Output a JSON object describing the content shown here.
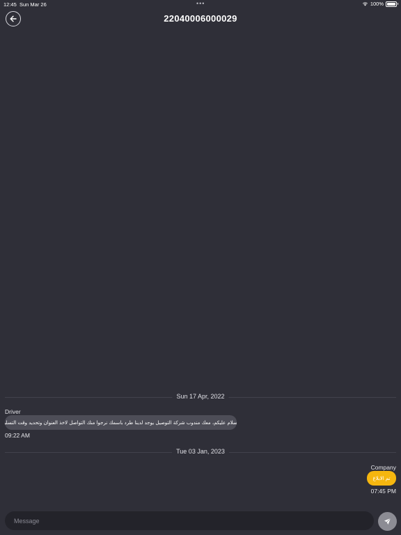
{
  "status_bar": {
    "time": "12:45",
    "date": "Sun Mar 26",
    "multitask_dots": "•••",
    "battery": "100%",
    "battery_level": 1.0
  },
  "header": {
    "title": "22040006000029",
    "back_icon": "arrow-left-icon"
  },
  "messages": [
    {
      "date_separator": "Sun 17 Apr, 2022",
      "sender": "Driver",
      "text": "السلام عليكم، معك مندوب شركة التوصيل يوجد لدينا طرد باسمك نرجوا منك التواصل لاخذ العنوان وتحديد وقت التسليم",
      "time": "09:22 AM",
      "direction": "incoming"
    },
    {
      "date_separator": "Tue 03 Jan, 2023",
      "sender": "Company",
      "text": "تم الابلاغ",
      "time": "07:45 PM",
      "direction": "outgoing"
    }
  ],
  "composer": {
    "placeholder": "Message",
    "value": "",
    "send_icon": "send-icon"
  },
  "colors": {
    "background": "#2f2f38",
    "incoming_bubble": "#4d4d57",
    "outgoing_bubble": "#f5b60f",
    "input_background": "#23232a",
    "send_button": "#8c8c94"
  }
}
